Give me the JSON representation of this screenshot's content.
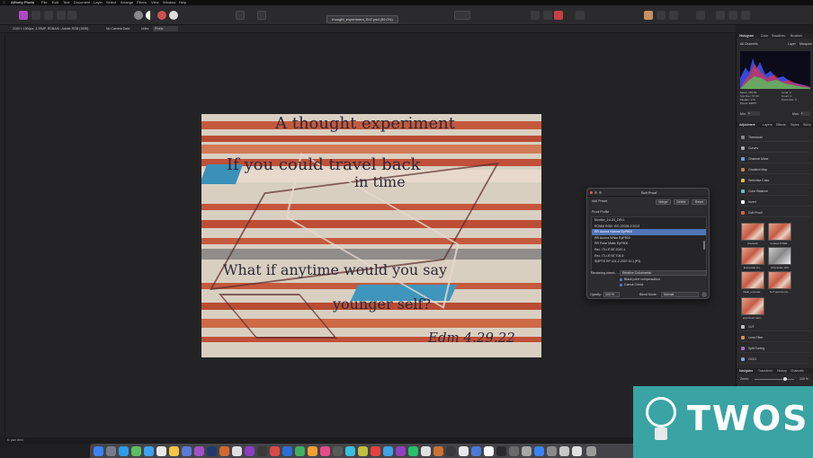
{
  "menubar": {
    "apple_icon": "apple-icon",
    "app_name": "Affinity Photo",
    "items": [
      "File",
      "Edit",
      "Text",
      "Document",
      "Layer",
      "Select",
      "Arrange",
      "Filters",
      "View",
      "Window",
      "Help"
    ]
  },
  "toolbar": {
    "document_title": "thought_experiment_Ed7.psd (59.0%)"
  },
  "contextbar": {
    "doc_info": "2100 × 1500px, 3.15MP, RGBA/8 - Adobe RGB (1998)",
    "camera": "No Camera Data",
    "units_label": "Units:",
    "units_value": "Pixels"
  },
  "artwork": {
    "line1": "A thought experiment",
    "line2": "If you could travel back",
    "line3": "in time",
    "line4": "What if anytime would you say",
    "line5": "younger self?",
    "signature": "Edm 4.29.22"
  },
  "soft_proof": {
    "title": "Soft Proof",
    "add_preset": "Add Preset",
    "merge": "Merge",
    "delete": "Delete",
    "reset": "Reset",
    "proof_profile_label": "Proof Profile",
    "profiles": [
      "Monitor_1U-24_DELL",
      "ROMM RGB: ISO 22028-2:2013",
      "RR Aurora Natural EpP800",
      "RR Aurora White EpP800",
      "RR Polar Matte EpP800",
      "Rec. ITU-R BT.2020-1",
      "Rec. ITU-R BT.709-5",
      "SMPTE RP 431-2-2007 DCI (P3)"
    ],
    "selected_index": 2,
    "rendering_intent_label": "Rendering Intent:",
    "rendering_intent_value": "Relative Colorimetric",
    "black_point": "Black point compensation",
    "gamut_check": "Gamut Check",
    "opacity_label": "Opacity:",
    "opacity_value": "100 %",
    "blend_mode_label": "Blend Mode:",
    "blend_mode_value": "Normal"
  },
  "right_panel": {
    "top_tabs": [
      "Histogram",
      "Color",
      "Swatches",
      "Brushes"
    ],
    "channel": "All Channels",
    "layer_tab": "Layer",
    "marquee_tab": "Marquee",
    "stats_left": [
      "Mean: 153.55",
      "Std. Dev: 57.03",
      "Median: 176",
      "Pixels: 96875"
    ],
    "stats_right": [
      "Level: 0",
      "Count: 0",
      "Percentile: 0"
    ],
    "min_label": "Min:",
    "min_value": "0",
    "max_label": "Max:",
    "max_value": "1",
    "adj_tabs": [
      "Adjustment",
      "Layers",
      "Effects",
      "Styles",
      "Stock"
    ],
    "adjustments": [
      {
        "label": "Threshold",
        "color": "#888888"
      },
      {
        "label": "Curves",
        "color": "#aaaaaa"
      },
      {
        "label": "Channel Mixer",
        "color": "#6aa0d8"
      },
      {
        "label": "Gradient Map",
        "color": "#d08040"
      },
      {
        "label": "Selective Color",
        "color": "#e0c040"
      },
      {
        "label": "Color Balance",
        "color": "#60c0c0"
      },
      {
        "label": "Invert",
        "color": "#ffffff"
      },
      {
        "label": "Soft Proof",
        "color": "#d86048"
      }
    ],
    "presets": [
      "(Default)",
      "Coated FOGR...",
      "Euroscale Co...",
      "Grayscale 1D2",
      "Iiliaik_uncoate...",
      "FuT aurora nat...",
      "aurora art natu..."
    ],
    "more_adjustments": [
      {
        "label": "LUT",
        "color": "#c0c0c0"
      },
      {
        "label": "Lens Filter",
        "color": "#e09050"
      },
      {
        "label": "Split Toning",
        "color": "#a070c0"
      },
      {
        "label": "OCIO",
        "color": "#80a0e0"
      }
    ],
    "nav_tabs": [
      "Navigator",
      "Transform",
      "History",
      "Channels"
    ],
    "zoom_label": "Zoom:",
    "zoom_value": "100 %"
  },
  "statusbar": {
    "hint": "to pan view."
  },
  "watermark": {
    "text": "TWOS"
  }
}
